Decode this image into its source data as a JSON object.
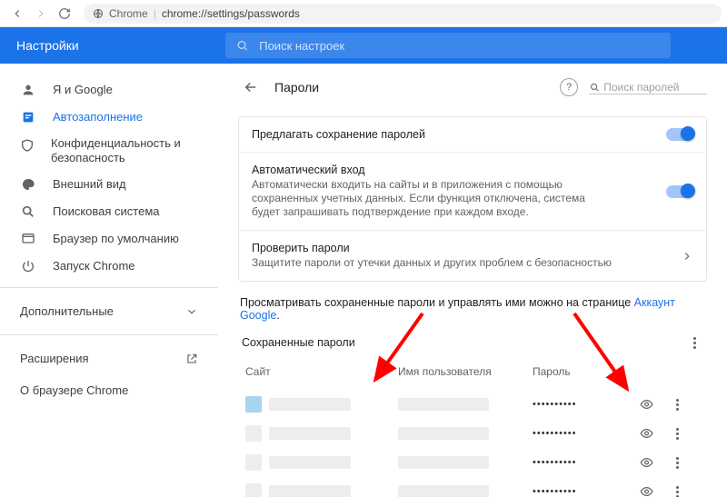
{
  "omnibox": {
    "host": "Chrome",
    "path": "chrome://settings/passwords"
  },
  "header": {
    "title": "Настройки",
    "search_ph": "Поиск настроек"
  },
  "sidebar": {
    "items": [
      {
        "label": "Я и Google"
      },
      {
        "label": "Автозаполнение"
      },
      {
        "label": "Конфиденциальность и безопасность"
      },
      {
        "label": "Внешний вид"
      },
      {
        "label": "Поисковая система"
      },
      {
        "label": "Браузер по умолчанию"
      },
      {
        "label": "Запуск Chrome"
      }
    ],
    "more": "Дополнительные",
    "ext": "Расширения",
    "about": "О браузере Chrome"
  },
  "page": {
    "title": "Пароли",
    "search_ph": "Поиск паролей",
    "offer_save": "Предлагать сохранение паролей",
    "auto_t": "Автоматический вход",
    "auto_d": "Автоматически входить на сайты и в приложения с помощью сохраненных учетных данных. Если функция отключена, система будет запрашивать подтверждение при каждом входе.",
    "check_t": "Проверить пароли",
    "check_d": "Защитите пароли от утечки данных и других проблем с безопасностью",
    "view_pre": "Просматривать сохраненные пароли и управлять ими можно на странице ",
    "view_link": "Аккаунт Google",
    "saved_t": "Сохраненные пароли",
    "col_site": "Сайт",
    "col_user": "Имя пользователя",
    "col_pass": "Пароль",
    "mask": "••••••••••"
  }
}
